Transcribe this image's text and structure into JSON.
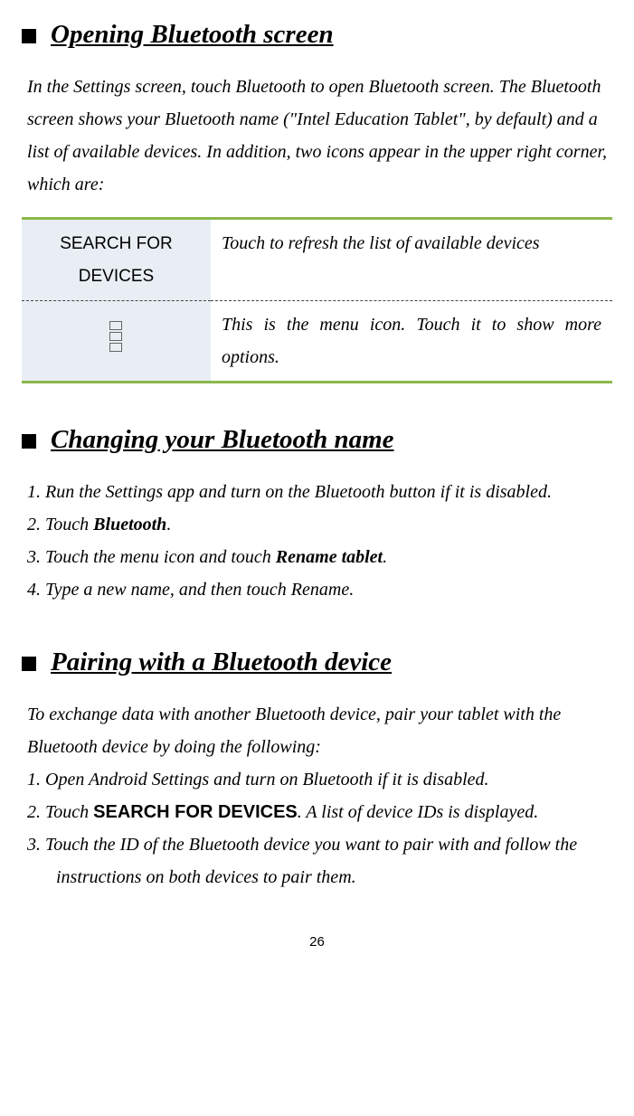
{
  "sections": {
    "opening": {
      "title": "Opening Bluetooth screen",
      "intro": "In the Settings screen, touch Bluetooth to open Bluetooth screen. The Bluetooth screen shows your Bluetooth name (\"Intel Education Tablet\", by default) and a list of available devices. In addition, two icons appear in the upper right corner, which are:",
      "table": {
        "rows": [
          {
            "left": "SEARCH FOR DEVICES",
            "right": "Touch to refresh the list of available devices"
          },
          {
            "left_icon": "menu-stack",
            "right": "This is the menu icon. Touch it to show more options."
          }
        ]
      }
    },
    "changing": {
      "title": "Changing your Bluetooth name",
      "steps": [
        {
          "pre": "1. Run the Settings app and turn on the Bluetooth button if it is disabled."
        },
        {
          "pre": "2. Touch ",
          "bold": "Bluetooth",
          "post": "."
        },
        {
          "pre": "3. Touch the menu icon and touch ",
          "bold": "Rename tablet",
          "post": "."
        },
        {
          "pre": "4. Type a new name, and then touch Rename."
        }
      ]
    },
    "pairing": {
      "title": "Pairing with a Bluetooth device",
      "intro": "To exchange data with another Bluetooth device, pair your tablet with the Bluetooth device by doing the following:",
      "steps": [
        {
          "pre": "1. Open Android Settings and turn on Bluetooth if it is disabled."
        },
        {
          "pre": "2. Touch ",
          "bold_sans": "SEARCH FOR DEVICES",
          "post": ". A list of device IDs is displayed."
        },
        {
          "pre": "3. Touch the ID of the Bluetooth device you want to pair with and follow the instructions on both devices to pair them."
        }
      ]
    }
  },
  "page_number": "26"
}
